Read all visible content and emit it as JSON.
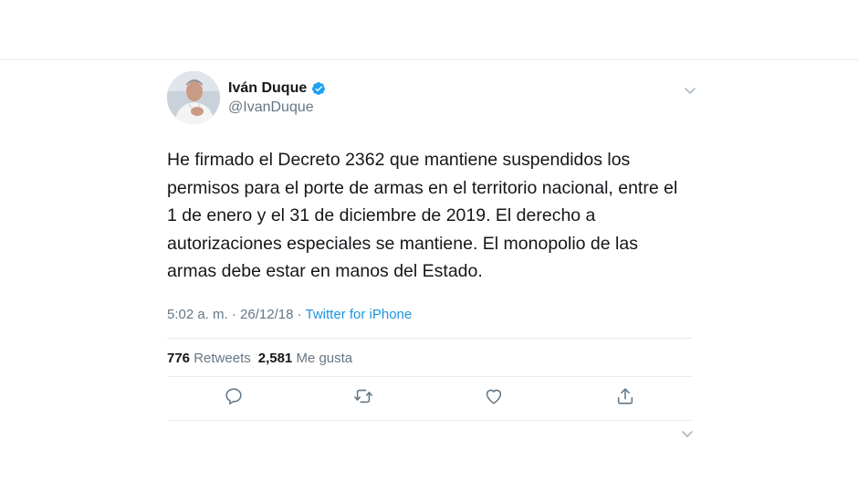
{
  "tweet": {
    "author": {
      "display_name": "Iván Duque",
      "handle": "@IvanDuque",
      "verified": true
    },
    "text": "He firmado el Decreto 2362 que mantiene suspendidos los permisos para el porte de armas en el territorio nacional, entre el 1 de enero y el 31 de diciembre de 2019. El derecho a autorizaciones especiales se mantiene. El monopolio de las armas debe estar en manos del Estado.",
    "time": "5:02 a. m.",
    "separator": "·",
    "date": "26/12/18",
    "source": "Twitter for iPhone",
    "retweets_count": "776",
    "retweets_label": "Retweets",
    "likes_count": "2,581",
    "likes_label": "Me gusta"
  },
  "icons": {
    "verified": "verified-badge-icon",
    "caret": "chevron-down-icon",
    "reply": "reply-icon",
    "retweet": "retweet-icon",
    "like": "heart-icon",
    "share": "share-icon"
  },
  "colors": {
    "accent": "#1DA1F2",
    "link": "#1B95E0",
    "secondary_text": "#657786",
    "divider": "#E6ECF0"
  }
}
